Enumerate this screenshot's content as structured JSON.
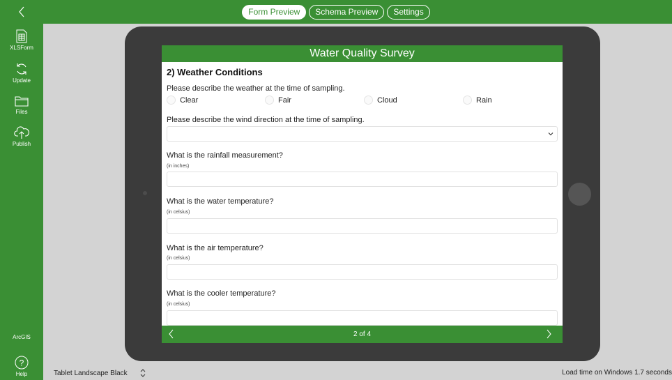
{
  "tabs": [
    "Form Preview",
    "Schema Preview",
    "Settings"
  ],
  "sidebar": {
    "items": [
      {
        "label": "XLSForm",
        "icon": "spreadsheet-icon"
      },
      {
        "label": "Update",
        "icon": "refresh-icon"
      },
      {
        "label": "Files",
        "icon": "folder-icon"
      },
      {
        "label": "Publish",
        "icon": "cloud-upload-icon"
      }
    ],
    "arcgis_label": "ArcGIS",
    "help_label": "Help"
  },
  "bottombar": {
    "device": "Tablet Landscape Black",
    "load_time": "Load time on Windows 1.7 seconds"
  },
  "form": {
    "title": "Water Quality Survey",
    "group_title": "2) Weather Conditions",
    "weather_question": "Please describe the weather at the time of sampling.",
    "weather_options": [
      "Clear",
      "Fair",
      "Cloud",
      "Rain"
    ],
    "wind_question": "Please describe the wind direction at the time of sampling.",
    "wind_value": "",
    "questions": [
      {
        "label": "What is the rainfall measurement?",
        "hint": "(in inches)",
        "value": ""
      },
      {
        "label": "What is the water temperature?",
        "hint": "(in celsius)",
        "value": ""
      },
      {
        "label": "What is the air temperature?",
        "hint": "(in celsius)",
        "value": ""
      },
      {
        "label": "What is the cooler temperature?",
        "hint": "(in celsius)",
        "value": ""
      }
    ],
    "page_indicator": "2 of 4"
  },
  "colors": {
    "accent": "#3a8f34",
    "background": "#d3d3d3",
    "tablet": "#3b3b3b"
  }
}
